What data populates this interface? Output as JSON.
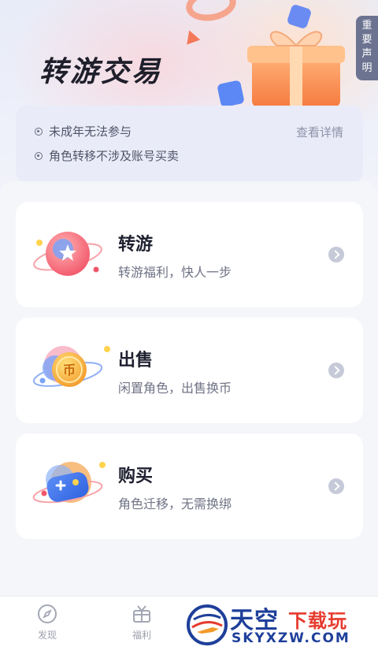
{
  "header": {
    "title": "转游交易",
    "notice_tab": [
      "重",
      "要",
      "声",
      "明"
    ]
  },
  "info": {
    "lines": [
      "未成年无法参与",
      "角色转移不涉及账号买卖"
    ],
    "details_link": "查看详情"
  },
  "cards": [
    {
      "title": "转游",
      "subtitle": "转游福利，快人一步",
      "icon": "star-orb-icon"
    },
    {
      "title": "出售",
      "subtitle": "闲置角色，出售换币",
      "icon": "coin-orb-icon"
    },
    {
      "title": "购买",
      "subtitle": "角色迁移，无需换绑",
      "icon": "gamepad-orb-icon"
    }
  ],
  "tabbar": {
    "items": [
      {
        "label": "发现",
        "icon": "compass-icon"
      },
      {
        "label": "福利",
        "icon": "gift-box-icon"
      }
    ]
  },
  "watermark": {
    "cn_main": "天空",
    "cn_sub": "下载玩",
    "en": "SKYXZW.COM"
  },
  "colors": {
    "title_text": "#1e1f2b",
    "notice_tab_bg": "#6b7390",
    "info_card_bg": "#e9ebf8",
    "watermark_blue": "#1e3f9a",
    "watermark_red": "#e63b2e"
  }
}
